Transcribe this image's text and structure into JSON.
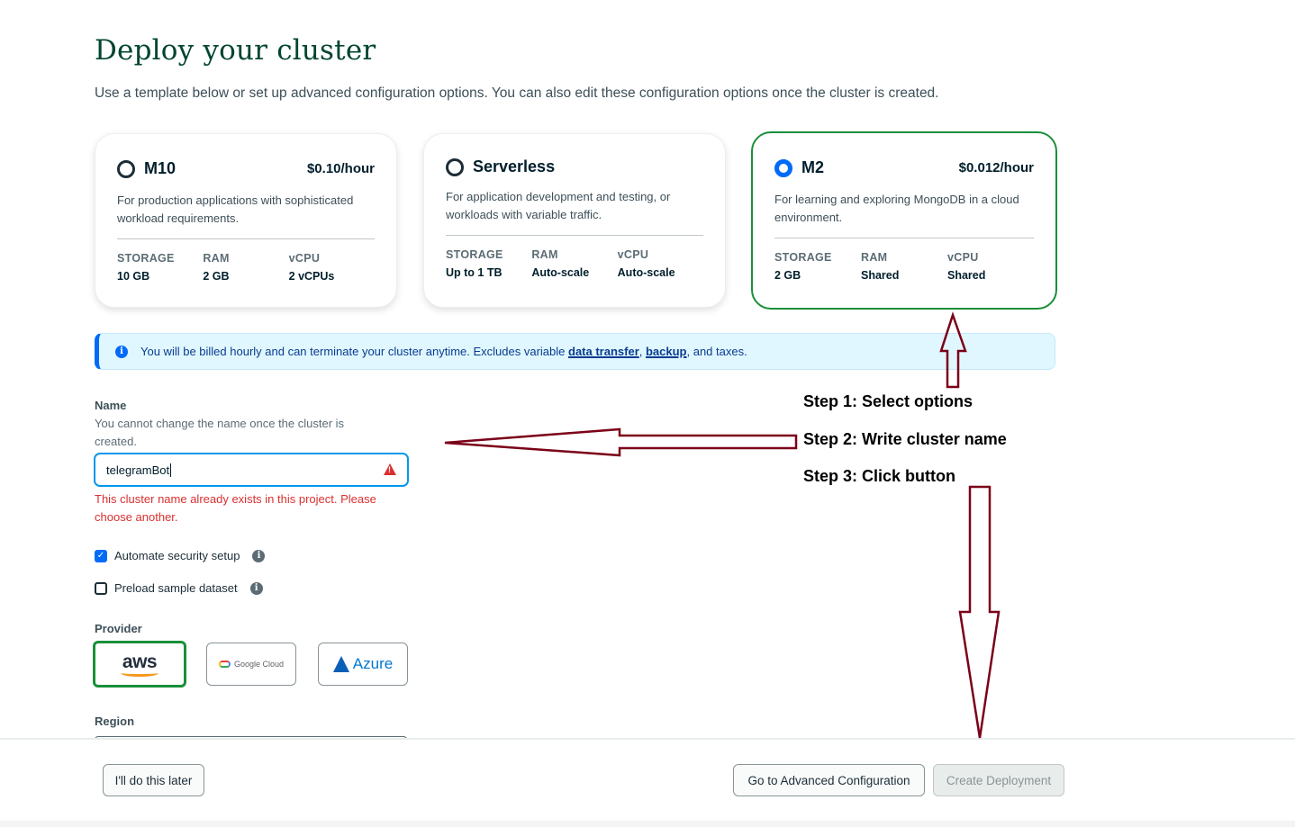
{
  "page": {
    "title": "Deploy your cluster",
    "subtitle": "Use a template below or set up advanced configuration options. You can also edit these configuration options once the cluster is created."
  },
  "tiers": [
    {
      "name": "M10",
      "price": "$0.10/hour",
      "selected": false,
      "description": "For production applications with sophisticated workload requirements.",
      "specs": [
        {
          "label": "STORAGE",
          "value": "10 GB"
        },
        {
          "label": "RAM",
          "value": "2 GB"
        },
        {
          "label": "vCPU",
          "value": "2 vCPUs"
        }
      ]
    },
    {
      "name": "Serverless",
      "price": "",
      "selected": false,
      "description": "For application development and testing, or workloads with variable traffic.",
      "specs": [
        {
          "label": "STORAGE",
          "value": "Up to 1 TB"
        },
        {
          "label": "RAM",
          "value": "Auto-scale"
        },
        {
          "label": "vCPU",
          "value": "Auto-scale"
        }
      ]
    },
    {
      "name": "M2",
      "price": "$0.012/hour",
      "selected": true,
      "description": "For learning and exploring MongoDB in a cloud environment.",
      "specs": [
        {
          "label": "STORAGE",
          "value": "2 GB"
        },
        {
          "label": "RAM",
          "value": "Shared"
        },
        {
          "label": "vCPU",
          "value": "Shared"
        }
      ]
    }
  ],
  "banner": {
    "text_before": "You will be billed hourly and can terminate your cluster anytime. Excludes variable ",
    "link_data_transfer": "data transfer",
    "comma": ", ",
    "link_backup": "backup",
    "text_after": ", and taxes."
  },
  "name_field": {
    "label": "Name",
    "help": "You cannot change the name once the cluster is created.",
    "value": "telegramBot",
    "error": "This cluster name already exists in this project. Please choose another."
  },
  "options": {
    "automate_security": {
      "label": "Automate security setup",
      "checked": true
    },
    "preload_sample": {
      "label": "Preload sample dataset",
      "checked": false
    }
  },
  "provider": {
    "label": "Provider",
    "options": [
      {
        "name": "aws",
        "selected": true
      },
      {
        "name": "Google Cloud",
        "selected": false
      },
      {
        "name": "Azure",
        "selected": false
      }
    ]
  },
  "region": {
    "label": "Region"
  },
  "footer": {
    "later": "I'll do this later",
    "advanced": "Go to Advanced Configuration",
    "create": "Create Deployment"
  },
  "annotations": {
    "step1": "Step 1: Select options",
    "step2": "Step 2: Write cluster name",
    "step3": "Step 3: Click button",
    "arrow_color": "#7b0018"
  },
  "colors": {
    "title_green": "#00452f",
    "selected_border": "#1a8f3a",
    "radio_blue": "#016bf8",
    "error_red": "#db3030",
    "input_focus": "#0498ec"
  }
}
